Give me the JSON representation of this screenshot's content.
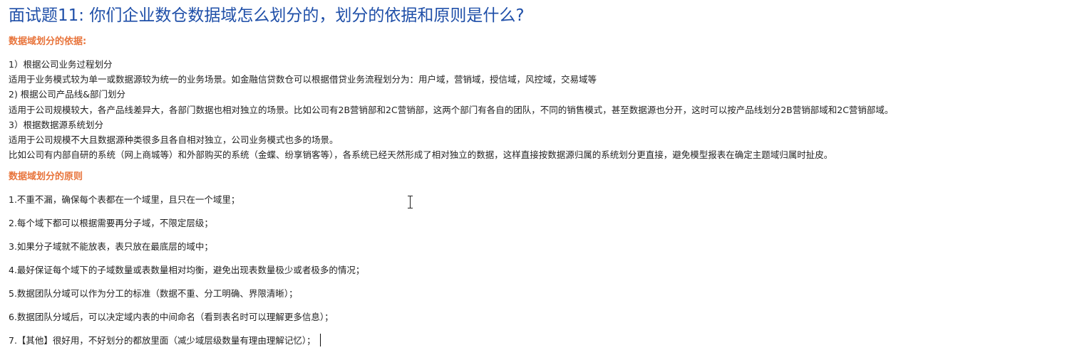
{
  "title": "面试题11: 你们企业数仓数据域怎么划分的，划分的依据和原则是什么?",
  "basis": {
    "heading": "数据域划分的依据:",
    "lines": [
      "1）根据公司业务过程划分",
      "适用于业务模式较为单一或数据源较为统一的业务场景。如金融信贷数仓可以根据借贷业务流程划分为：用户域，营销域，授信域，风控域，交易域等",
      "2) 根据公司产品线&部门划分",
      "适用于公司规模较大，各产品线差异大，各部门数据也相对独立的场景。比如公司有2B营销部和2C营销部，这两个部门有各自的团队，不同的销售模式，甚至数据源也分开，这时可以按产品线划分2B营销部域和2C营销部域。",
      "3）根据数据源系统划分",
      "适用于公司规模不大且数据源种类很多且各自相对独立，公司业务模式也多的场景。",
      "比如公司有内部自研的系统（网上商城等）和外部购买的系统（金蝶、纷享销客等），各系统已经天然形成了相对独立的数据，这样直接按数据源归属的系统划分更直接，避免模型报表在确定主题域归属时扯皮。"
    ]
  },
  "principles": {
    "heading": "数据域划分的原则",
    "items": [
      "1.不重不漏，确保每个表都在一个域里，且只在一个域里；",
      "2.每个域下都可以根据需要再分子域，不限定层级；",
      "3.如果分子域就不能放表，表只放在最底层的域中；",
      "4.最好保证每个域下的子域数量或表数量相对均衡，避免出现表数量极少或者极多的情况；",
      "5.数据团队分域可以作为分工的标准（数据不重、分工明确、界限清晰）；",
      "6.数据团队分域后，可以决定域内表的中间命名（看到表名时可以理解更多信息）；",
      "7.【其他】很好用，不好划分的都放里面（减少域层级数量有理由理解记忆）；"
    ]
  }
}
